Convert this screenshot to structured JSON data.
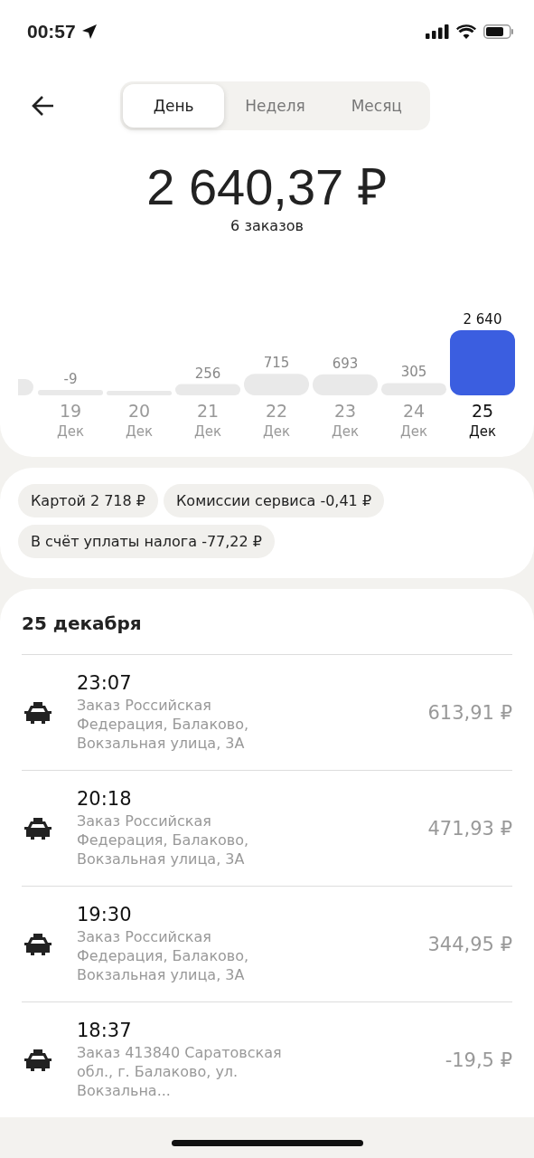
{
  "status_bar": {
    "time": "00:57"
  },
  "period_tabs": [
    {
      "label": "День",
      "selected": true
    },
    {
      "label": "Неделя",
      "selected": false
    },
    {
      "label": "Месяц",
      "selected": false
    }
  ],
  "total": {
    "amount": "2 640,37 ₽",
    "orders": "6 заказов"
  },
  "day_bars": [
    {
      "value": "-9",
      "day": "19",
      "month": "Дек",
      "selected": false
    },
    {
      "day": "20",
      "month": "Дек",
      "selected": false
    },
    {
      "value": "256",
      "day": "21",
      "month": "Дек",
      "selected": false
    },
    {
      "value": "715",
      "day": "22",
      "month": "Дек",
      "selected": false
    },
    {
      "value": "693",
      "day": "23",
      "month": "Дек",
      "selected": false
    },
    {
      "value": "305",
      "day": "24",
      "month": "Дек",
      "selected": false
    },
    {
      "value": "2 640",
      "day": "25",
      "month": "Дек",
      "selected": true
    }
  ],
  "summary_chips": [
    "Картой 2 718 ₽",
    "Комиссии сервиса -0,41 ₽",
    "В счёт уплаты налога -77,22 ₽"
  ],
  "orders": {
    "date": "25 декабря",
    "rows": [
      {
        "time": "23:07",
        "address": "Заказ Российская Федерация, Балаково, Вокзальная улица, 3А",
        "amount": "613,91 ₽"
      },
      {
        "time": "20:18",
        "address": "Заказ Российская Федерация, Балаково, Вокзальная улица, 3А",
        "amount": "471,93 ₽"
      },
      {
        "time": "19:30",
        "address": "Заказ Российская Федерация, Балаково, Вокзальная улица, 3А",
        "amount": "344,95 ₽"
      },
      {
        "time": "18:37",
        "address": "Заказ 413840 Саратовская обл., г. Балаково, ул. Вокзальна...",
        "amount": "-19,5 ₽"
      }
    ]
  }
}
